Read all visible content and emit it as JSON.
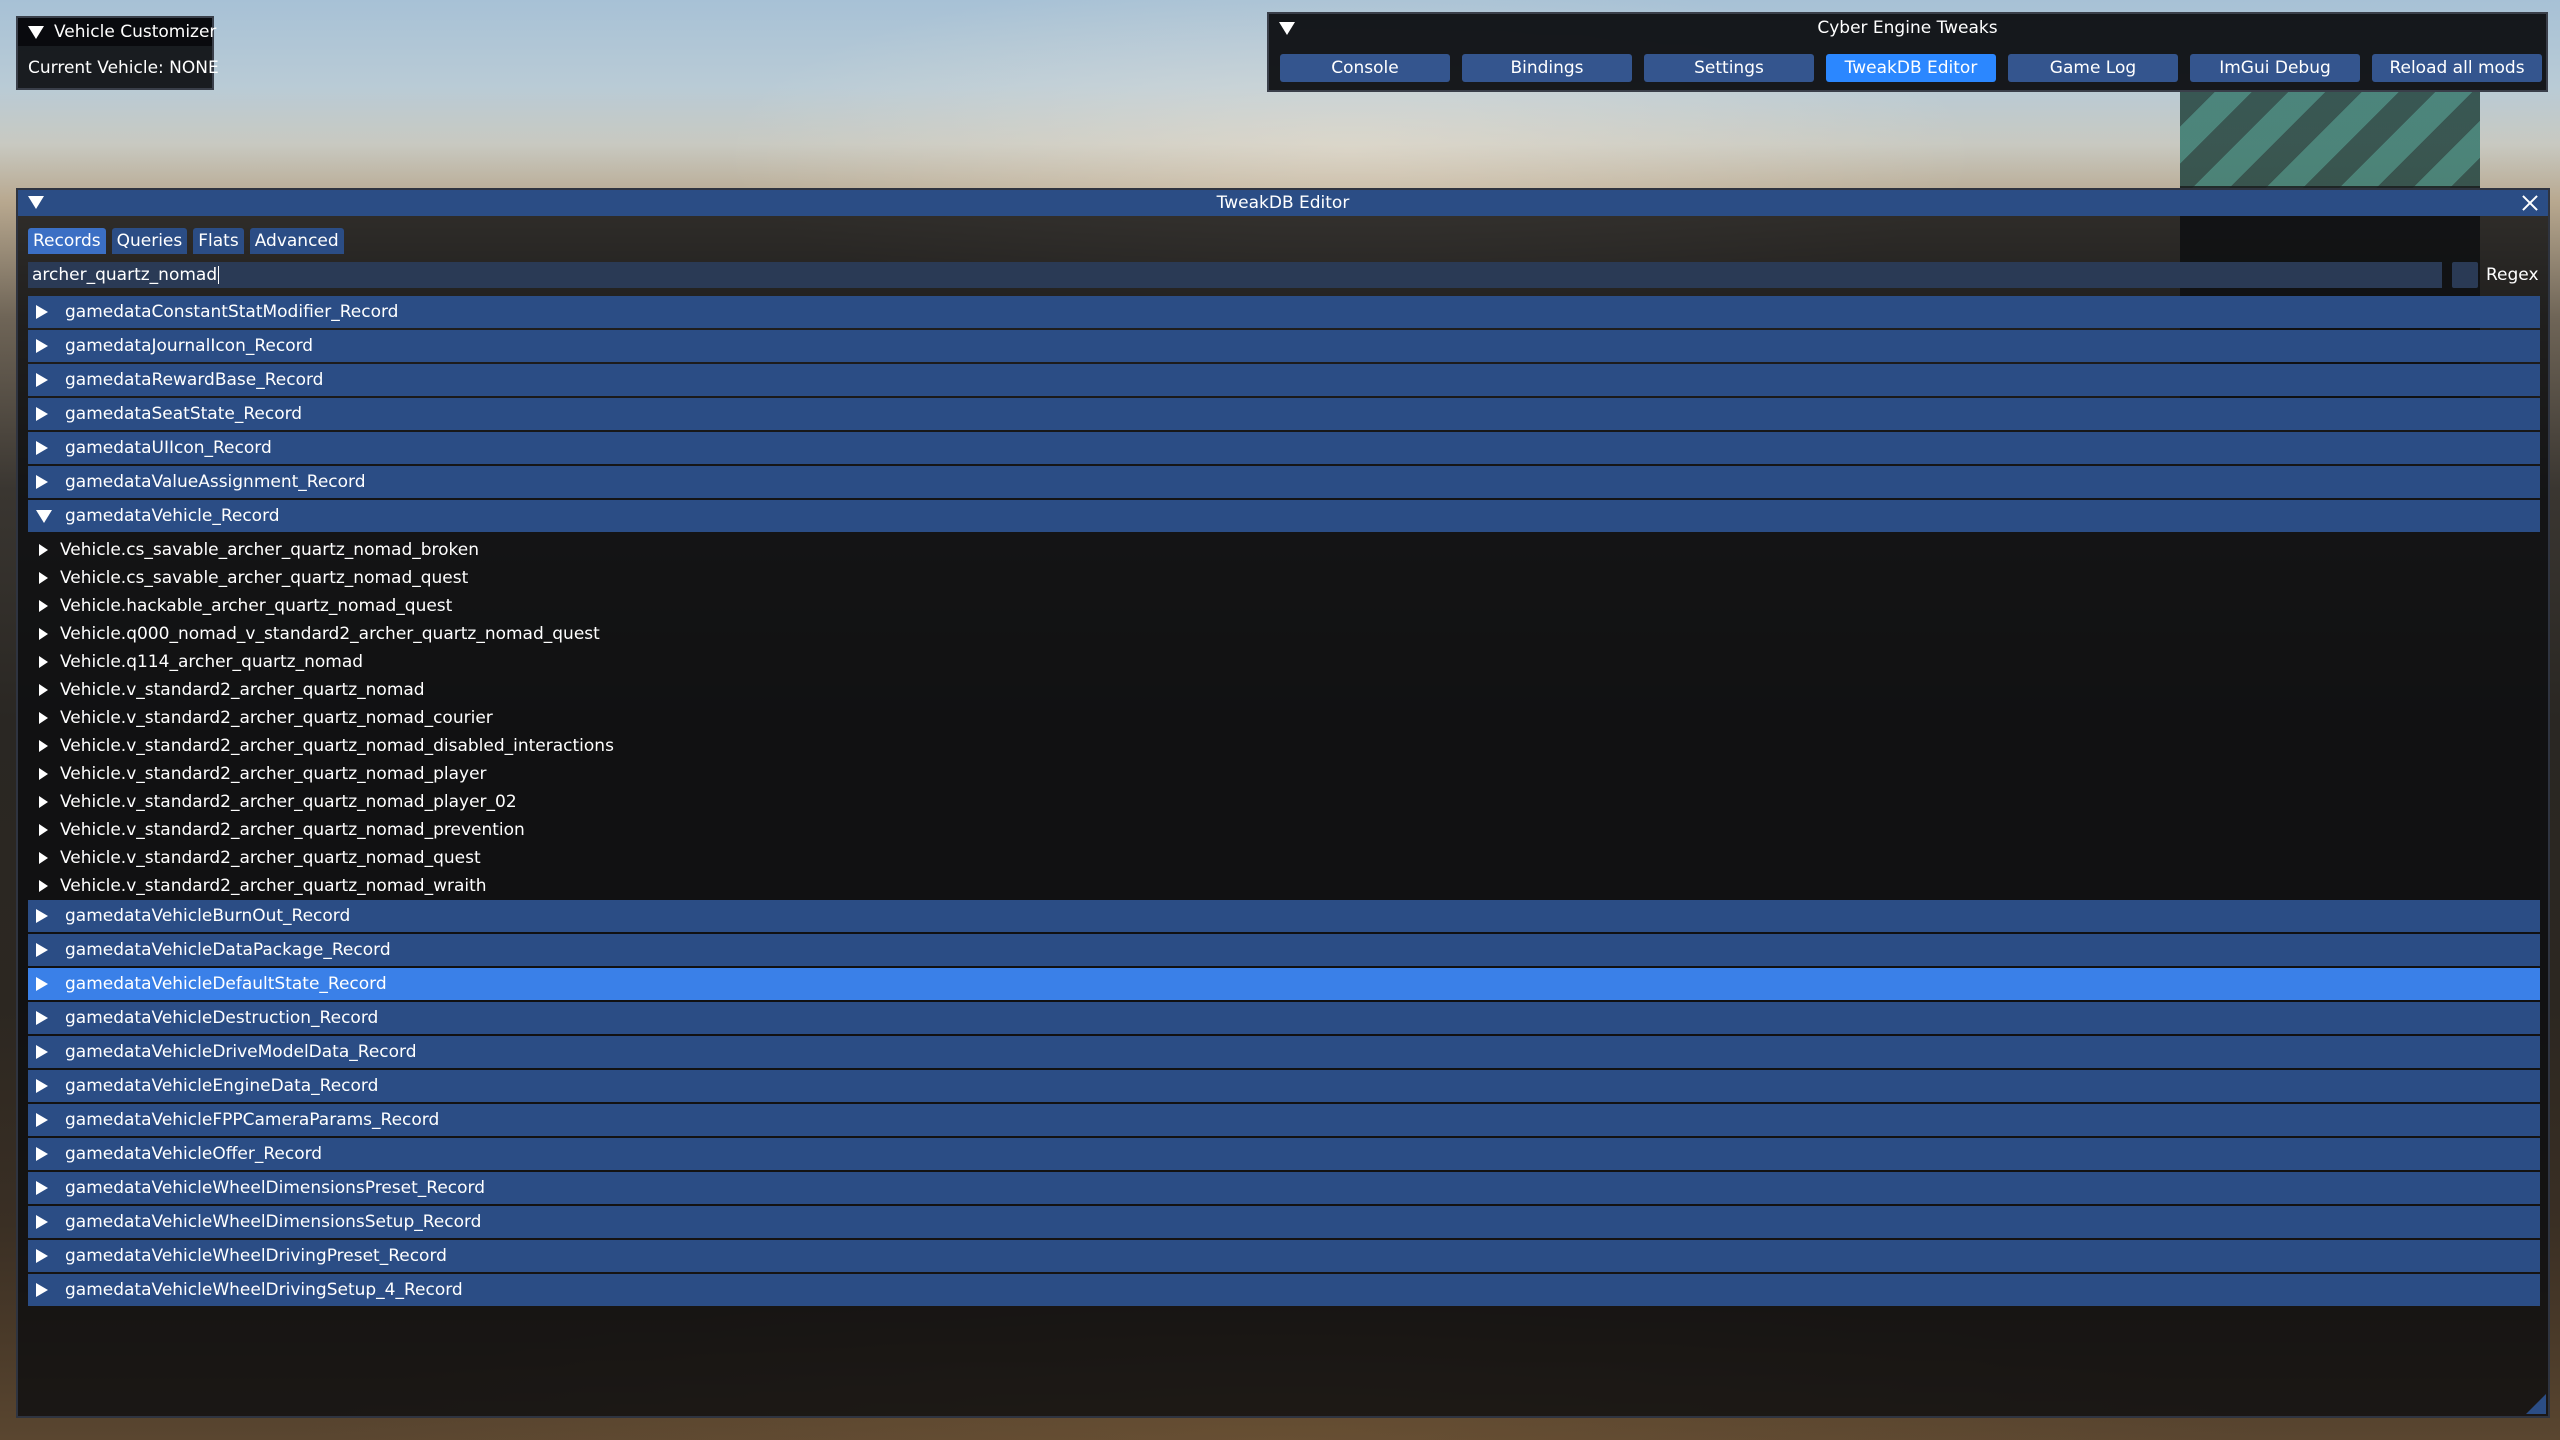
{
  "vehicle_customizer": {
    "title": "Vehicle Customizer",
    "current_vehicle": "Current Vehicle: NONE"
  },
  "cet": {
    "title": "Cyber Engine Tweaks",
    "buttons": [
      {
        "label": "Console"
      },
      {
        "label": "Bindings"
      },
      {
        "label": "Settings"
      },
      {
        "label": "TweakDB Editor"
      },
      {
        "label": "Game Log"
      },
      {
        "label": "ImGui Debug"
      },
      {
        "label": "Reload all mods"
      }
    ]
  },
  "tweakdb": {
    "title": "TweakDB Editor",
    "tabs": [
      {
        "label": "Records"
      },
      {
        "label": "Queries"
      },
      {
        "label": "Flats"
      },
      {
        "label": "Advanced"
      }
    ],
    "search_value": "archer_quartz_nomad",
    "regex_label": "Regex",
    "records_before": [
      {
        "label": "gamedataConstantStatModifier_Record"
      },
      {
        "label": "gamedataJournalIcon_Record"
      },
      {
        "label": "gamedataRewardBase_Record"
      },
      {
        "label": "gamedataSeatState_Record"
      },
      {
        "label": "gamedataUIIcon_Record"
      },
      {
        "label": "gamedataValueAssignment_Record"
      }
    ],
    "expanded_record": {
      "label": "gamedataVehicle_Record",
      "children": [
        "Vehicle.cs_savable_archer_quartz_nomad_broken",
        "Vehicle.cs_savable_archer_quartz_nomad_quest",
        "Vehicle.hackable_archer_quartz_nomad_quest",
        "Vehicle.q000_nomad_v_standard2_archer_quartz_nomad_quest",
        "Vehicle.q114_archer_quartz_nomad",
        "Vehicle.v_standard2_archer_quartz_nomad",
        "Vehicle.v_standard2_archer_quartz_nomad_courier",
        "Vehicle.v_standard2_archer_quartz_nomad_disabled_interactions",
        "Vehicle.v_standard2_archer_quartz_nomad_player",
        "Vehicle.v_standard2_archer_quartz_nomad_player_02",
        "Vehicle.v_standard2_archer_quartz_nomad_prevention",
        "Vehicle.v_standard2_archer_quartz_nomad_quest",
        "Vehicle.v_standard2_archer_quartz_nomad_wraith"
      ]
    },
    "records_after": [
      {
        "label": "gamedataVehicleBurnOut_Record"
      },
      {
        "label": "gamedataVehicleDataPackage_Record"
      },
      {
        "label": "gamedataVehicleDefaultState_Record"
      },
      {
        "label": "gamedataVehicleDestruction_Record"
      },
      {
        "label": "gamedataVehicleDriveModelData_Record"
      },
      {
        "label": "gamedataVehicleEngineData_Record"
      },
      {
        "label": "gamedataVehicleFPPCameraParams_Record"
      },
      {
        "label": "gamedataVehicleOffer_Record"
      },
      {
        "label": "gamedataVehicleWheelDimensionsPreset_Record"
      },
      {
        "label": "gamedataVehicleWheelDimensionsSetup_Record"
      },
      {
        "label": "gamedataVehicleWheelDrivingPreset_Record"
      },
      {
        "label": "gamedataVehicleWheelDrivingSetup_4_Record"
      }
    ]
  },
  "colors": {
    "title_bg": "#2b4d85",
    "button_bg": "#34558e",
    "active_accent": "#2b87ff",
    "selected_row": "#3a80e8"
  }
}
